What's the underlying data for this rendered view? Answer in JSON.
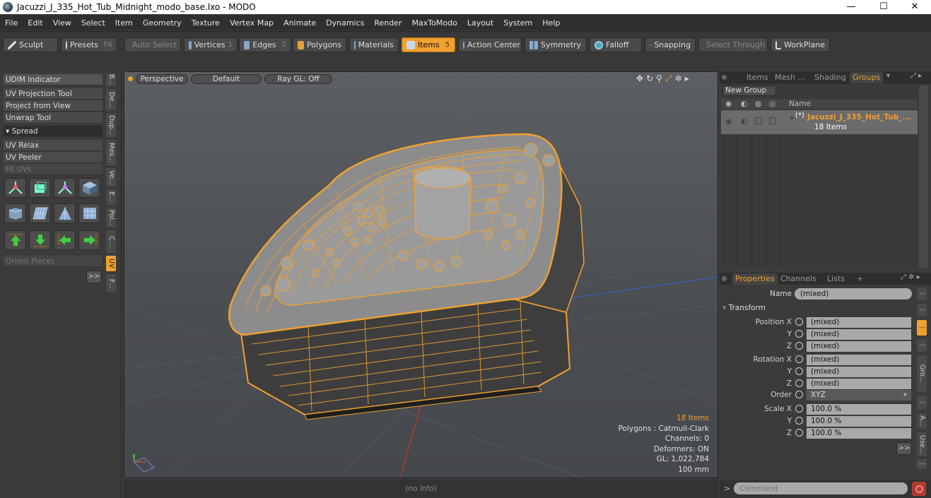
{
  "window": {
    "title": "Jacuzzi_J_335_Hot_Tub_Midnight_modo_base.lxo - MODO",
    "minimize": "—",
    "maximize": "☐",
    "close": "✕"
  },
  "menu": [
    "File",
    "Edit",
    "View",
    "Select",
    "Item",
    "Geometry",
    "Texture",
    "Vertex Map",
    "Animate",
    "Dynamics",
    "Render",
    "MaxToModo",
    "Layout",
    "System",
    "Help"
  ],
  "toolbar": {
    "sculpt": "Sculpt",
    "presets": "Presets",
    "presets_key": "F6",
    "auto_select": "Auto Select",
    "vertices": "Vertices",
    "vertices_key": "1",
    "edges": "Edges",
    "edges_key": "2",
    "polygons": "Polygons",
    "materials": "Materials",
    "items": "Items",
    "items_key": "5",
    "action_center": "Action Center",
    "symmetry": "Symmetry",
    "falloff": "Falloff",
    "snapping": "Snapping",
    "select_through": "Select Through",
    "workplane": "WorkPlane"
  },
  "left_panel": {
    "rows": [
      "UDIM Indicator",
      "UV Projection Tool",
      "Project from View",
      "Unwrap Tool"
    ],
    "spread": "Spread",
    "rows2": [
      "UV Relax",
      "UV Peeler",
      "Fit UVs"
    ],
    "orient_pieces": "Orient Pieces",
    "more": ">>",
    "vtabs": [
      "B...",
      "De...",
      "Dup...",
      "Mes...",
      "Ve...",
      "E...",
      "Pol...",
      "C...",
      "UV",
      "F..."
    ]
  },
  "viewport": {
    "mode": "Perspective",
    "style": "Default",
    "raygl": "Ray GL: Off",
    "stats": {
      "items": "18 Items",
      "polygons": "Polygons : Catmull-Clark",
      "channels": "Channels: 0",
      "deformers": "Deformers: ON",
      "gl": "GL: 1,022,784",
      "scale": "100 mm"
    },
    "status": "(no info)"
  },
  "groups_panel": {
    "tabs": [
      "Items",
      "Mesh ...",
      "Shading",
      "Groups"
    ],
    "new_group": "New Group",
    "name_col": "Name",
    "item_name": "Jacuzzi_J_335_Hot_Tub_...",
    "item_count": "18 Items"
  },
  "properties": {
    "tabs": [
      "Properties",
      "Channels",
      "Lists",
      "+"
    ],
    "name_label": "Name",
    "name_value": "(mixed)",
    "transform": "Transform",
    "position_label": "Position X",
    "rotation_label": "Rotation X",
    "scale_label": "Scale X",
    "y": "Y",
    "z": "Z",
    "mixed": "(mixed)",
    "order_label": "Order",
    "order_value": "XYZ",
    "scale_value": "100.0 %",
    "more": ">>",
    "side_tabs": [
      "Gro...",
      "A...",
      "Use..."
    ]
  },
  "command": {
    "prompt": ">",
    "placeholder": "Command"
  },
  "colors": {
    "accent": "#f0a030",
    "wire": "#f0a030",
    "bg": "#3c3c3c"
  }
}
